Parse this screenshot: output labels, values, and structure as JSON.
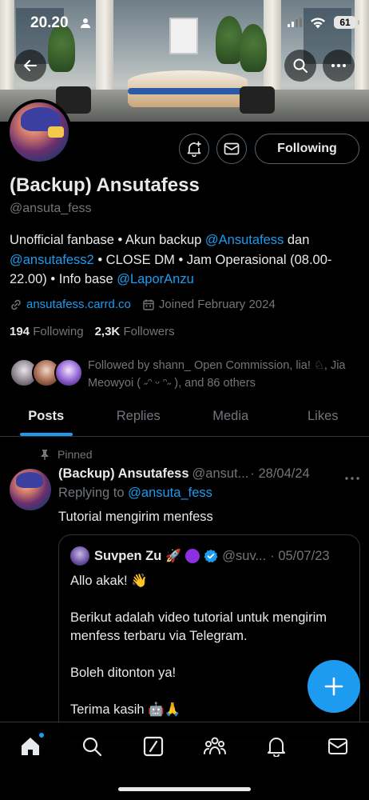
{
  "status_bar": {
    "time": "20.20",
    "battery": "61"
  },
  "profile": {
    "name": "(Backup) Ansutafess",
    "handle": "@ansuta_fess",
    "bio": {
      "part1": "Unofficial fanbase • Akun backup ",
      "mention1": "@Ansutafess",
      "part2": " dan ",
      "mention2": "@ansutafess2",
      "part3": " • CLOSE DM • Jam Operasional (08.00-22.00) • Info base ",
      "mention3": "@LaporAnzu"
    },
    "website": "ansutafess.carrd.co",
    "joined": "Joined February 2024",
    "following_count": "194",
    "following_label": "Following",
    "followers_count": "2,3K",
    "followers_label": "Followers",
    "followed_by": "Followed by shann_ Open Commission, lia! ♘, Jia Meowyoi ( ˶ᵔ ᵕ ᵔ˶ ), and 86 others",
    "follow_button": "Following"
  },
  "tabs": [
    {
      "label": "Posts"
    },
    {
      "label": "Replies"
    },
    {
      "label": "Media"
    },
    {
      "label": "Likes"
    }
  ],
  "pinned_tweet": {
    "pinned_label": "Pinned",
    "author_name": "(Backup) Ansutafess",
    "author_handle": "@ansut...",
    "date": "· 28/04/24",
    "replying_prefix": "Replying to ",
    "replying_to": "@ansuta_fess",
    "text": "Tutorial mengirim menfess",
    "quote": {
      "author_name": "Suvpen Zu",
      "author_emoji": "🚀",
      "author_handle": "@suv...",
      "date": "· 05/07/23",
      "line1": "Allo akak! 👋",
      "line2": "Berikut adalah video tutorial untuk mengirim menfess terbaru via Telegram.",
      "line3": "Boleh ditonton ya!",
      "line4": "Terima kasih 🤖🙏"
    }
  },
  "colors": {
    "accent": "#1d9bf0",
    "background": "#000000",
    "muted": "#71767b"
  }
}
